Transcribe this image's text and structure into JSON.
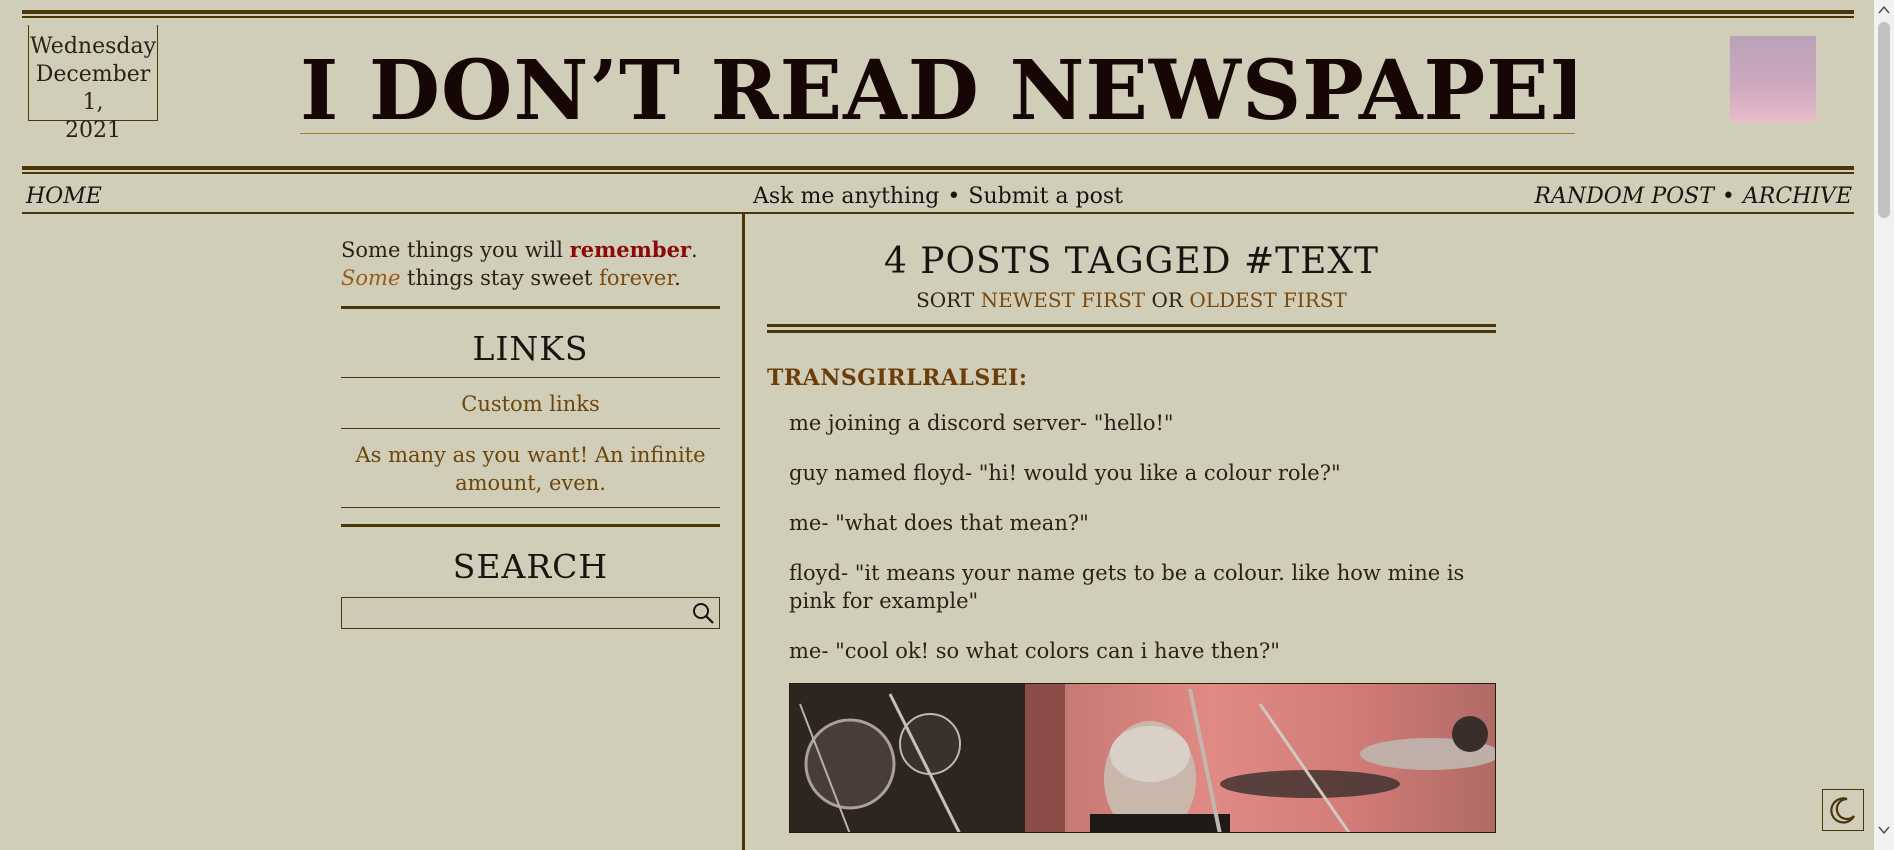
{
  "header": {
    "date_lines": [
      "Wednesday",
      "December 1,",
      "2021"
    ],
    "title": "I DON’T READ NEWSPAPERS"
  },
  "nav": {
    "home": "HOME",
    "ask": "Ask me anything",
    "submit": "Submit a post",
    "random": "RANDOM POST",
    "archive": "ARCHIVE",
    "separator": "•"
  },
  "sidebar": {
    "quote": {
      "p1": "Some things you will ",
      "remember": "remember",
      "p2": ". ",
      "some": "Some",
      "p3": " things stay sweet ",
      "forever": "forever",
      "p4": "."
    },
    "links_title": "LINKS",
    "links": [
      "Custom links",
      "As many as you want! An infinite amount, even."
    ],
    "search_title": "SEARCH",
    "search_placeholder": ""
  },
  "main": {
    "tag_title": "4 POSTS TAGGED #TEXT",
    "sort_label": "SORT",
    "sort_newest": "NEWEST FIRST",
    "sort_or": "OR",
    "sort_oldest": "OLDEST FIRST",
    "post": {
      "author": "TRANSGIRLRALSEI:",
      "lines": [
        "me joining a discord server- \"hello!\"",
        "guy named floyd- \"hi! would you like a colour role?\"",
        "me- \"what does that mean?\"",
        "floyd- \"it means your name gets to be a colour. like how mine is pink for example\"",
        "me- \"cool ok! so what colors can i have then?\""
      ]
    }
  },
  "icons": {
    "search": "search-icon",
    "theme": "moon-icon",
    "stamp": "stamp-image"
  },
  "colors": {
    "background": "#d0cdb9",
    "rule": "#4a3608",
    "link": "#7a4a10",
    "accent_red": "#8a0a0a"
  }
}
